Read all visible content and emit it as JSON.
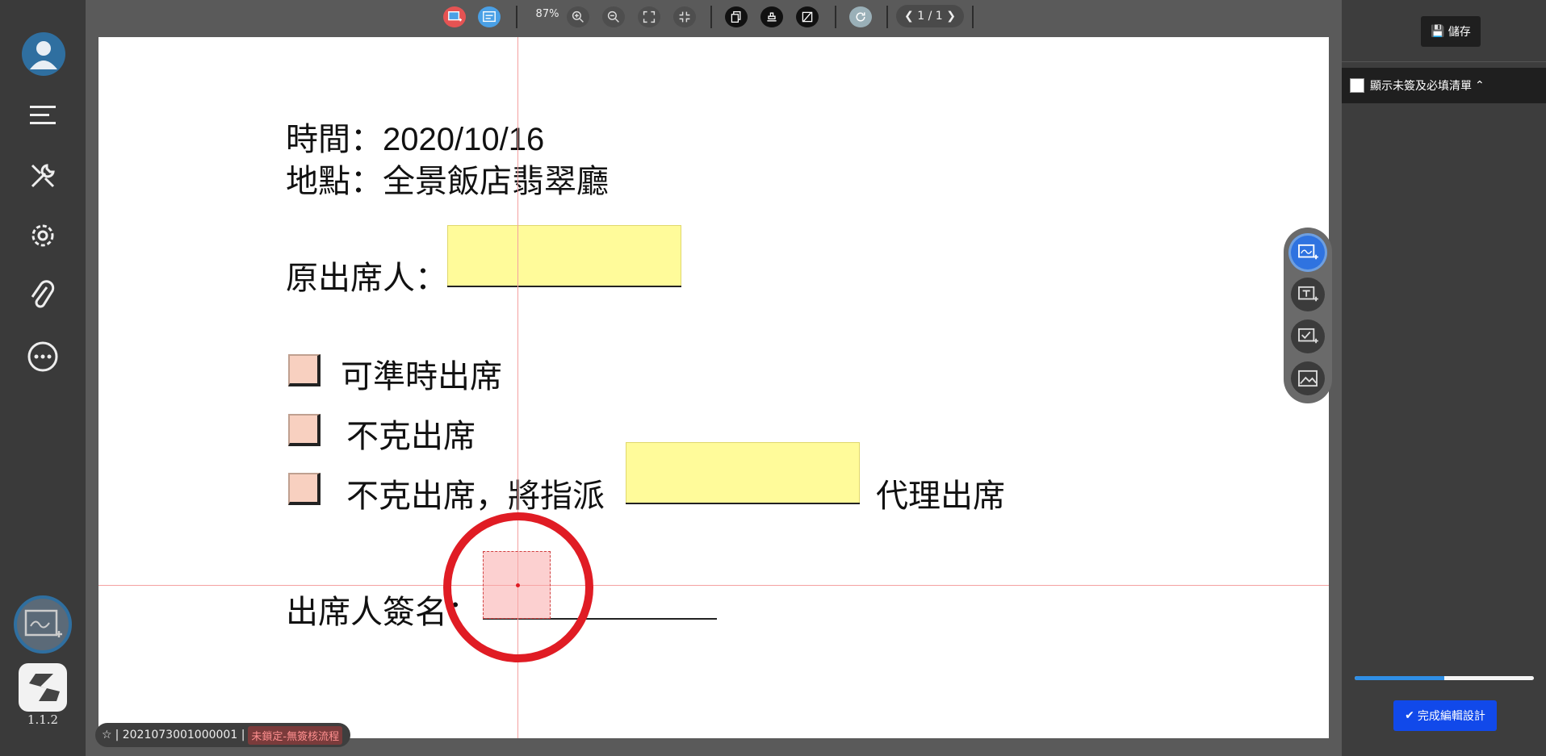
{
  "sidebar": {
    "items": [
      {
        "icon": "user-avatar-icon"
      },
      {
        "icon": "menu-icon"
      },
      {
        "icon": "tools-icon"
      },
      {
        "icon": "settings-gear-icon"
      },
      {
        "icon": "paperclip-icon"
      },
      {
        "icon": "more-options-icon"
      }
    ],
    "active_tool_icon": "signature-field-icon",
    "version": "1.1.2"
  },
  "toolbar": {
    "zoom_label": "87%",
    "page_indicator": "1 / 1",
    "icons": [
      "add-signature-field-icon",
      "add-form-icon",
      "zoom-in-icon",
      "zoom-out-icon",
      "fit-page-icon",
      "fit-width-icon",
      "copy-icon",
      "stamp-icon",
      "no-sign-icon",
      "refresh-icon",
      "prev-page-icon",
      "next-page-icon"
    ]
  },
  "document": {
    "line_time": "時間：2020/10/16",
    "line_place": "地點：全景飯店翡翠廳",
    "original_attendee_label": "原出席人：",
    "option_1": "可準時出席",
    "option_2": "不克出席",
    "option_3_prefix": "不克出席，將指派",
    "option_3_suffix": "代理出席",
    "signature_label": "出席人簽名："
  },
  "floating_tools": [
    "signature-field-icon",
    "text-field-icon",
    "checkbox-field-icon",
    "image-field-icon"
  ],
  "info_pill": {
    "id_text": "| 2021073001000001 |",
    "status": "未鎖定-無簽核流程"
  },
  "right_panel": {
    "save_label": "儲存",
    "checklist_label": "顯示未簽及必填清單",
    "progress_fraction": 0.5,
    "finish_label": "完成編輯設計"
  },
  "colors": {
    "accent_blue": "#1149ea",
    "active_tool_blue": "#2f73e0",
    "field_yellow": "#fffb9a",
    "target_red": "#e01c24",
    "progress_blue": "#2f8fe6"
  }
}
